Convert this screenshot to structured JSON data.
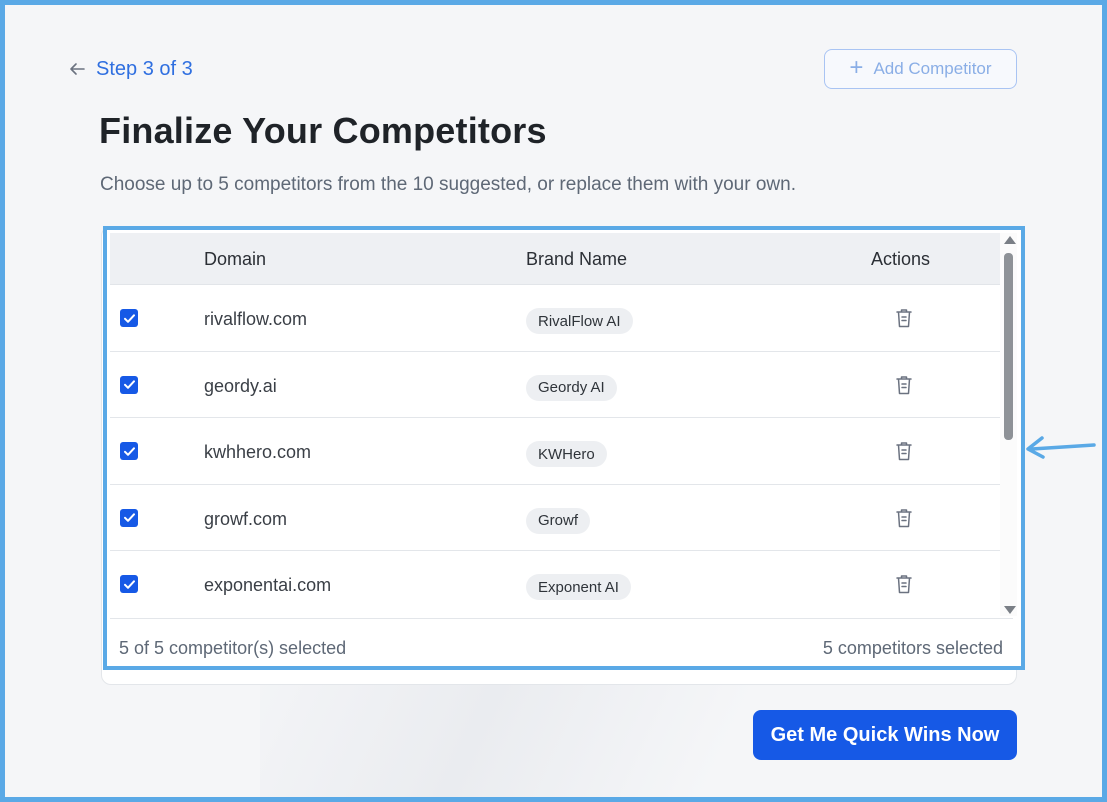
{
  "nav": {
    "back_label": "Step 3 of 3",
    "add_competitor_label": "Add Competitor"
  },
  "page": {
    "title": "Finalize Your Competitors",
    "subtitle": "Choose up to 5 competitors from the 10 suggested, or replace them with your own."
  },
  "table": {
    "headers": {
      "domain": "Domain",
      "brand": "Brand Name",
      "actions": "Actions"
    },
    "rows": [
      {
        "checked": true,
        "domain": "rivalflow.com",
        "brand": "RivalFlow AI"
      },
      {
        "checked": true,
        "domain": "geordy.ai",
        "brand": "Geordy AI"
      },
      {
        "checked": true,
        "domain": "kwhhero.com",
        "brand": "KWHero"
      },
      {
        "checked": true,
        "domain": "growf.com",
        "brand": "Growf"
      },
      {
        "checked": true,
        "domain": "exponentai.com",
        "brand": "Exponent AI"
      }
    ],
    "footer": {
      "left": "5 of 5 competitor(s) selected",
      "right": "5 competitors selected"
    }
  },
  "cta": {
    "label": "Get Me Quick Wins Now"
  },
  "icons": {
    "back": "arrow-left-icon",
    "add": "plus-icon",
    "checkbox": "checkmark-icon",
    "delete": "trash-icon",
    "annotation": "arrow-left-icon"
  },
  "colors": {
    "accent": "#1659e6",
    "link": "#2f6fe0",
    "highlight": "#5aa9e6"
  }
}
